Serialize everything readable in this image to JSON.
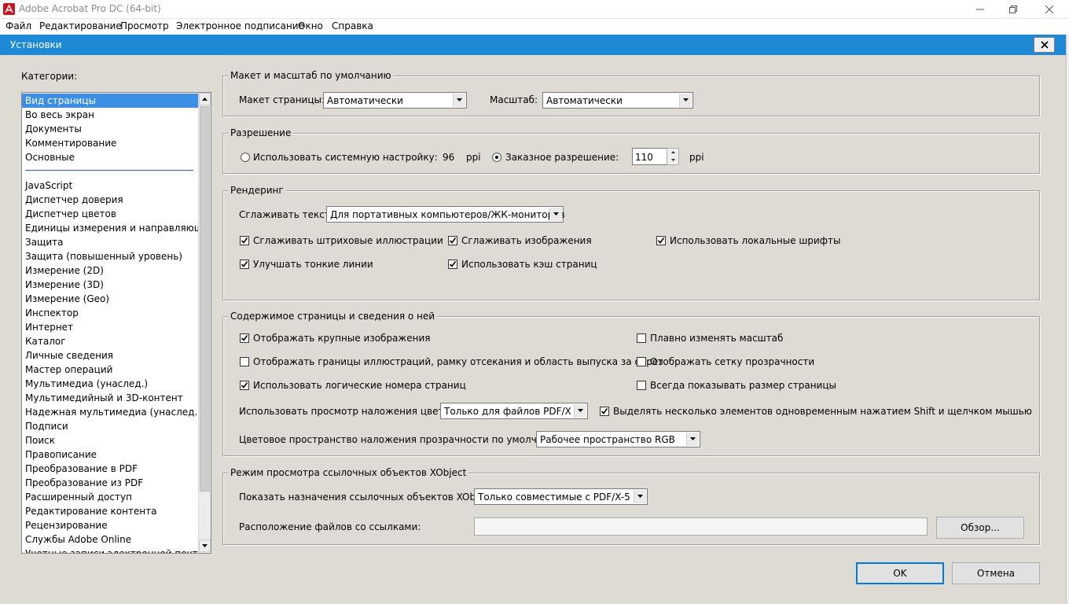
{
  "app": {
    "title": "Adobe Acrobat Pro DC (64-bit)",
    "icon": "acrobat-icon",
    "controls": [
      "minimize-icon",
      "restore-icon",
      "close-icon"
    ]
  },
  "menu": [
    "Файл",
    "Редактирование",
    "Просмотр",
    "Электронное подписание",
    "Окно",
    "Справка"
  ],
  "dialog": {
    "title": "Установки",
    "accent": "#1e8ad6",
    "categories_label": "Категории:",
    "categories_top": [
      "Вид страницы",
      "Во весь экран",
      "Документы",
      "Комментирование",
      "Основные"
    ],
    "categories": [
      "JavaScript",
      "Диспетчер доверия",
      "Диспетчер цветов",
      "Единицы измерения и направляющие",
      "Защита",
      "Защита (повышенный уровень)",
      "Измерение (2D)",
      "Измерение (3D)",
      "Измерение (Geo)",
      "Инспектор",
      "Интернет",
      "Каталог",
      "Личные сведения",
      "Мастер операций",
      "Мультимедиа (унаслед.)",
      "Мультимедийный и 3D-контент",
      "Надежная мультимедиа (унаслед.)",
      "Подписи",
      "Поиск",
      "Правописание",
      "Преобразование в PDF",
      "Преобразование из PDF",
      "Расширенный доступ",
      "Редактирование контента",
      "Рецензирование",
      "Службы Adobe Online",
      "Учетные записи электронной почты"
    ],
    "selected_category": "Вид страницы",
    "layout": {
      "title": "Макет и масштаб по умолчанию",
      "page_layout_label": "Макет страницы:",
      "page_layout_value": "Автоматически",
      "zoom_label": "Масштаб:",
      "zoom_value": "Автоматически"
    },
    "resolution": {
      "title": "Разрешение",
      "system_label": "Использовать системную настройку:",
      "system_value": "96",
      "unit": "ppi",
      "custom_label": "Заказное разрешение:",
      "custom_value": "110",
      "selected": "custom"
    },
    "rendering": {
      "title": "Рендеринг",
      "smooth_text_label": "Сглаживать текст:",
      "smooth_text_value": "Для портативных компьютеров/ЖК-мониторов",
      "smooth_line_art": {
        "label": "Сглаживать штриховые иллюстрации",
        "checked": true
      },
      "smooth_images": {
        "label": "Сглаживать изображения",
        "checked": true
      },
      "local_fonts": {
        "label": "Использовать локальные шрифты",
        "checked": true
      },
      "enhance_thin_lines": {
        "label": "Улучшать тонкие линии",
        "checked": true
      },
      "page_cache": {
        "label": "Использовать кэш страниц",
        "checked": true
      }
    },
    "content": {
      "title": "Содержимое страницы и сведения о ней",
      "large_images": {
        "label": "Отображать крупные изображения",
        "checked": true
      },
      "smooth_zoom": {
        "label": "Плавно изменять масштаб",
        "checked": false
      },
      "art_trim_bleed": {
        "label": "Отображать границы иллюстраций, рамку отсекания и область выпуска за обрез",
        "checked": false
      },
      "transparency_grid": {
        "label": "Отображать сетку прозрачности",
        "checked": false
      },
      "logical_page_numbers": {
        "label": "Использовать логические номера страниц",
        "checked": true
      },
      "always_show_page_size": {
        "label": "Всегда показывать размер страницы",
        "checked": false
      },
      "overprint_label": "Использовать просмотр наложения цветов:",
      "overprint_value": "Только для файлов PDF/X",
      "shift_click": {
        "label": "Выделять несколько элементов одновременным нажатием Shift и щелчком мышью",
        "checked": true
      },
      "blend_space_label": "Цветовое пространство наложения прозрачности по умолчанию:",
      "blend_space_value": "Рабочее пространство RGB"
    },
    "xobject": {
      "title": "Режим просмотра ссылочных объектов XObject",
      "targets_label": "Показать назначения ссылочных объектов XObject:",
      "targets_value": "Только совместимые с PDF/X-5",
      "location_label": "Расположение файлов со ссылками:",
      "location_value": "",
      "browse": "Обзор..."
    },
    "ok": "OK",
    "cancel": "Отмена"
  }
}
